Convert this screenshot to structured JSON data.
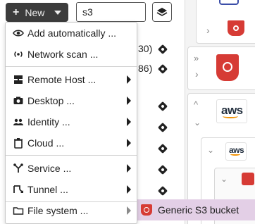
{
  "toolbar": {
    "new_label": "New",
    "search_value": "s3"
  },
  "background_rows": [
    {
      "text": "30)"
    },
    {
      "text": "86)"
    }
  ],
  "menu": {
    "items": [
      {
        "label": "Add automatically ...",
        "icon": "eye-icon",
        "submenu": false
      },
      {
        "label": "Network scan ...",
        "icon": "network-scan-icon",
        "submenu": false
      },
      {
        "label": "Remote Host ...",
        "icon": "server-icon",
        "submenu": true
      },
      {
        "label": "Desktop ...",
        "icon": "camera-icon",
        "submenu": true
      },
      {
        "label": "Identity ...",
        "icon": "users-icon",
        "submenu": true
      },
      {
        "label": "Cloud ...",
        "icon": "delete-icon",
        "submenu": true
      },
      {
        "label": "Service ...",
        "icon": "service-icon",
        "submenu": true
      },
      {
        "label": "Tunnel ...",
        "icon": "tunnel-icon",
        "submenu": true
      },
      {
        "label": "File system ...",
        "icon": "folder-icon",
        "submenu": true
      }
    ]
  },
  "submenu": {
    "items": [
      {
        "label": "Generic S3 bucket",
        "icon": "s3-bucket-icon"
      }
    ]
  },
  "right_pane": {
    "aws_label": "aws"
  },
  "colors": {
    "highlight": "#e3cfe6",
    "dark_button": "#3c3c3c",
    "s3_red": "#d63b35",
    "aws_orange": "#f29100"
  }
}
